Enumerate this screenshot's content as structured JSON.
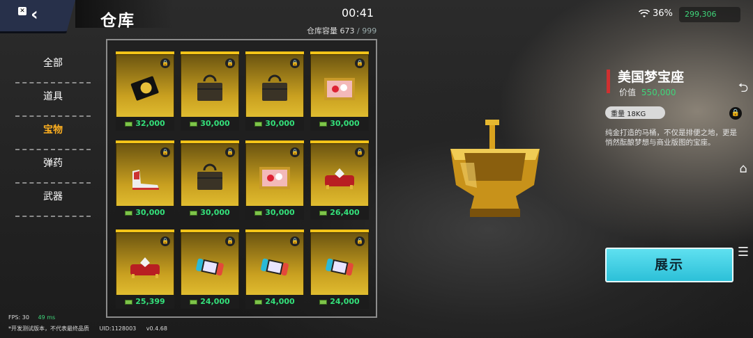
{
  "header": {
    "title": "仓库",
    "time": "00:41",
    "capacity_label": "仓库容量",
    "capacity_used": "673",
    "capacity_total": "/ 999",
    "battery": "36%",
    "money": "299,306"
  },
  "categories": [
    {
      "label": "全部",
      "active": false
    },
    {
      "label": "道具",
      "active": false
    },
    {
      "label": "宝物",
      "active": true
    },
    {
      "label": "弹药",
      "active": false
    },
    {
      "label": "武器",
      "active": false
    }
  ],
  "items": [
    {
      "icon": "card-icon",
      "price": "32,000"
    },
    {
      "icon": "briefcase-icon",
      "price": "30,000"
    },
    {
      "icon": "briefcase-icon",
      "price": "30,000"
    },
    {
      "icon": "painting-icon",
      "price": "30,000"
    },
    {
      "icon": "sneaker-icon",
      "price": "30,000"
    },
    {
      "icon": "briefcase-icon",
      "price": "30,000"
    },
    {
      "icon": "painting-icon",
      "price": "30,000"
    },
    {
      "icon": "cushion-gem-icon",
      "price": "26,400"
    },
    {
      "icon": "cushion-gem-icon",
      "price": "25,399"
    },
    {
      "icon": "game-console-icon",
      "price": "24,000"
    },
    {
      "icon": "game-console-icon",
      "price": "24,000"
    },
    {
      "icon": "game-console-icon",
      "price": "24,000"
    }
  ],
  "detail": {
    "name": "美国梦宝座",
    "value_label": "价值",
    "value": "550,000",
    "weight": "重量 18KG",
    "description": "纯金打造的马桶，不仅是排便之地，更是悄然酝酿梦想与商业版图的宝座。",
    "show_button": "展示"
  },
  "footer": {
    "fps": "FPS: 30",
    "ping": "49 ms",
    "notice": "*开发测试版本，不代表最终品质",
    "uid": "UID:1128003",
    "version": "v0.4.68"
  },
  "colors": {
    "accent_gold": "#f2c318",
    "price_green": "#34e07a",
    "active_category": "#ffb020",
    "show_button": "#2cc0d8"
  }
}
